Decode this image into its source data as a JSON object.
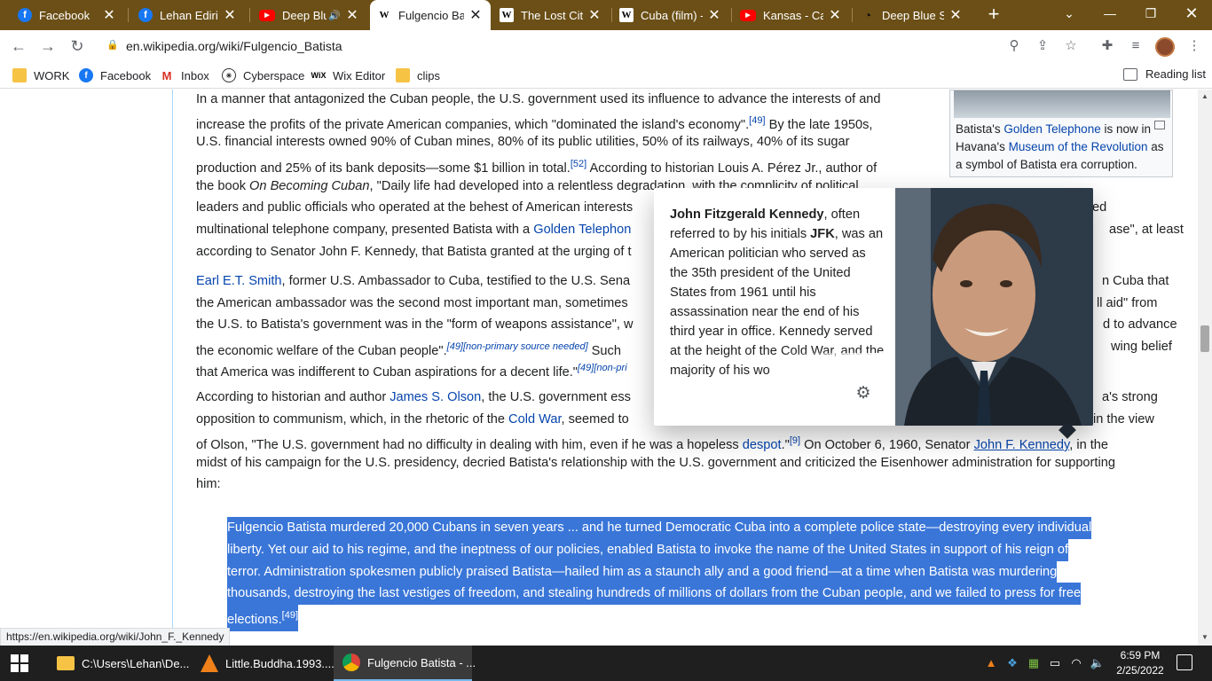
{
  "tabs": [
    {
      "icon": "facebook-icon",
      "label": "Facebook"
    },
    {
      "icon": "facebook-icon",
      "label": "Lehan Edirisin"
    },
    {
      "icon": "youtube-icon",
      "label": "Deep Blu"
    },
    {
      "icon": "wikipedia-icon",
      "label": "Fulgencio Bat",
      "active": true
    },
    {
      "icon": "wikipedia-icon",
      "label": "The Lost City"
    },
    {
      "icon": "wikipedia-icon",
      "label": "Cuba (film) - "
    },
    {
      "icon": "youtube-icon",
      "label": "Kansas - Carr"
    },
    {
      "icon": "deep-blue-icon",
      "label": "Deep Blue So"
    }
  ],
  "toolbar": {
    "url": "en.wikipedia.org/wiki/Fulgencio_Batista"
  },
  "bookmarks": [
    {
      "icon": "folder-icon",
      "label": "WORK"
    },
    {
      "icon": "facebook-icon",
      "label": "Facebook"
    },
    {
      "icon": "gmail-icon",
      "label": "Inbox"
    },
    {
      "icon": "cyberspace-icon",
      "label": "Cyberspace"
    },
    {
      "icon": "wix-icon",
      "label": "Wix Editor"
    },
    {
      "icon": "folder-icon",
      "label": "clips"
    }
  ],
  "reading_list": "Reading list",
  "infobox": {
    "caption_pre": "Batista's ",
    "caption_link1": "Golden Telephone",
    "caption_mid": " is now in Havana's ",
    "caption_link2": "Museum of the Revolution",
    "caption_post": " as a symbol of Batista era corruption."
  },
  "article": {
    "p1": [
      "In a manner that antagonized the Cuban people, the U.S. government used its influence to advance the interests of and",
      "increase the profits of the private American companies, which \"dominated the island's economy\".",
      " By the late 1950s,",
      "U.S. financial interests owned 90% of Cuban mines, 80% of its public utilities, 50% of its railways, 40% of its sugar",
      "production and 25% of its bank deposits—some $1 billion in total.",
      " According to historian Louis A. Pérez Jr., author of",
      "the book ",
      "On Becoming Cuban",
      ", \"Daily life had developed into a relentless degradation, with the complicity of political",
      "leaders and public officials who operated at the behest of American interests",
      "ed",
      "multinational telephone company, presented Batista with a ",
      "Golden Telephon",
      "ase\", at least",
      "according to Senator John F. Kennedy, that Batista granted at the urging of t"
    ],
    "sup_49": "[49]",
    "sup_52": "[52]",
    "p2": [
      "Earl E.T. Smith",
      ", former U.S. Ambassador to Cuba, testified to the U.S. Sena",
      "n Cuba that",
      "the American ambassador was the second most important man, sometimes",
      "ll aid\" from",
      "the U.S. to Batista's government was in the \"form of weapons assistance\", w",
      "d to advance",
      "the economic welfare of the Cuban people\".",
      "[49][non-primary source needed]",
      " Such",
      "wing belief",
      "that America was indifferent to Cuban aspirations for a decent life.\"",
      "[49][non-pri"
    ],
    "p3": [
      "According to historian and author ",
      "James S. Olson",
      ", the U.S. government ess",
      "a's strong",
      "opposition to communism, which, in the rhetoric of the ",
      "Cold War",
      ", seemed to",
      " in the view",
      "of Olson, \"The U.S. government had no difficulty in dealing with him, even if he was a hopeless ",
      "despot",
      ".\"",
      "[9]",
      " On October 6, 1960, Senator ",
      "John F. Kennedy",
      ", in the",
      "midst of his campaign for the U.S. presidency, decried Batista's relationship with the U.S. government and criticized the Eisenhower administration for supporting",
      "him:"
    ],
    "quote": [
      "Fulgencio Batista murdered 20,000 Cubans in seven years ... and he turned Democratic Cuba into a complete police state—destroying every individual",
      "liberty. Yet our aid to his regime, and the ineptness of our policies, enabled Batista to invoke the name of the United States in support of his reign of",
      "terror. Administration spokesmen publicly praised Batista—hailed him as a staunch ally and a good friend—at a time when Batista was murdering",
      "thousands, destroying the last vestiges of freedom, and stealing hundreds of millions of dollars from the Cuban people, and we failed to press for free",
      "elections.",
      "[49]"
    ]
  },
  "popup": {
    "name": "John Fitzgerald Kennedy",
    "t1": ", often referred to by his initials ",
    "initials": "JFK",
    "t2": ", was an American politician who served as the 35th president of the United States from 1961 until his assassination near the end of his third year in office. Kennedy served at the height of the Cold War, and the majority of his wo"
  },
  "status_url": "https://en.wikipedia.org/wiki/John_F._Kennedy",
  "taskbar": {
    "items": [
      {
        "icon": "folder-icon",
        "label": "C:\\Users\\Lehan\\De..."
      },
      {
        "icon": "vlc-icon",
        "label": "Little.Buddha.1993...."
      },
      {
        "icon": "chrome-icon",
        "label": "Fulgencio Batista - ..."
      }
    ],
    "time": "6:59 PM",
    "date": "2/25/2022"
  }
}
